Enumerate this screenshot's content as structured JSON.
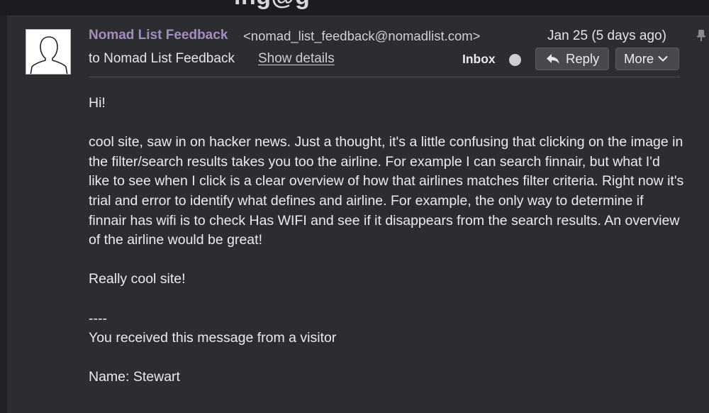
{
  "window": {
    "cut_off_title": "ing@g"
  },
  "email": {
    "sender_name": "Nomad List Feedback",
    "sender_email": "<nomad_list_feedback@nomadlist.com>",
    "date": "Jan 25 (5 days ago)",
    "to_line": "to Nomad List Feedback",
    "show_details": "Show details",
    "label": "Inbox"
  },
  "actions": {
    "reply_label": "Reply",
    "more_label": "More"
  },
  "body": {
    "greeting": "Hi!",
    "paragraph": "cool site, saw in on hacker news. Just a thought, it's a little confusing that clicking on the image in the filter/search results takes you too the airline. For example I can search finnair, but what I'd like to see when I click is a clear overview of how that airlines matches filter criteria. Right now it's trial and error to identify what defines and airline. For example, the only way to determine if finnair has wifi is to check Has WIFI and see if it disappears from the search results. An overview of the airline would be great!",
    "closing": "Really cool site!",
    "separator": "----",
    "visitor_line": "You received this message from a visitor",
    "name_line": "Name: Stewart"
  },
  "icons": {
    "avatar": "default-user-avatar-icon",
    "unread": "unread-dot-icon",
    "reply": "reply-arrow-icon",
    "more": "chevron-down-icon",
    "scroll": "pin-icon"
  },
  "colors": {
    "background": "#2c2d31",
    "sender_accent": "#a48dbf",
    "button": "#48494e"
  }
}
